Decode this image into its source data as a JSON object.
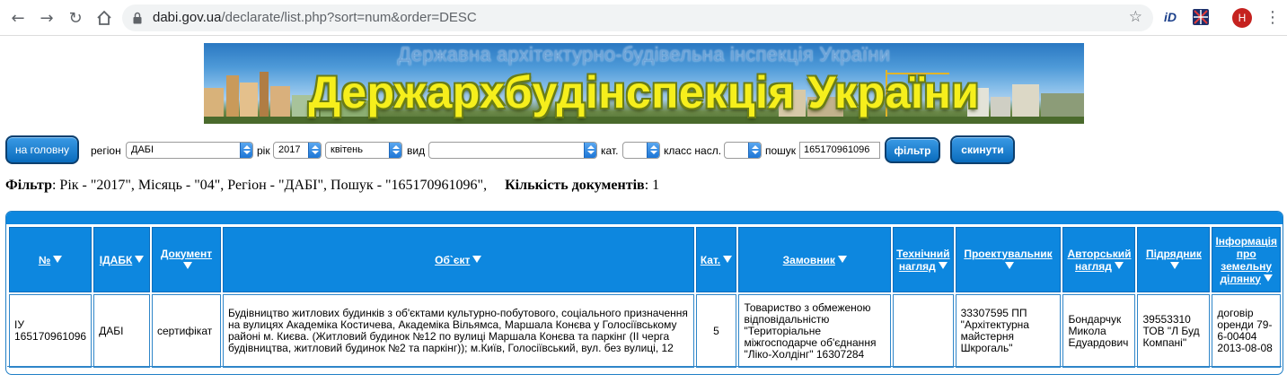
{
  "browser": {
    "url_host": "dabi.gov.ua",
    "url_path": "/declarate/list.php?sort=num&order=DESC",
    "avatar_letter": "H",
    "ext1_label": "iD"
  },
  "banner": {
    "subtitle": "Державна архітектурно-будівельна інспекція України",
    "title": "Держархбудінспекція України"
  },
  "form": {
    "home_button": "на головну",
    "region_label": "регіон",
    "region_value": "ДАБІ",
    "year_label": "рік",
    "year_value": "2017",
    "month_value": "квітень",
    "type_label": "вид",
    "type_value": "",
    "cat_label": "кат.",
    "cat_value": "",
    "class_label": "класс насл.",
    "class_value": "",
    "search_label": "пошук",
    "search_value": "165170961096",
    "filter_button": "фільтр",
    "reset_button": "скинути"
  },
  "filter_summary": {
    "label": "Фільтр",
    "text": ": Рік - \"2017\", Місяць - \"04\", Регіон - \"ДАБІ\", Пошук - \"165170961096\",",
    "count_label": "Кількість документів",
    "count_value": ": 1"
  },
  "table": {
    "headers": [
      "№",
      "ІДАБК",
      "Документ",
      "Об`єкт",
      "Кат.",
      "Замовник",
      "Технічний нагляд",
      "Проектувальник",
      "Авторський нагляд",
      "Підрядник",
      "Інформація про земельну ділянку"
    ],
    "rows": [
      {
        "num": "ІУ 165170961096",
        "idabk": "ДАБІ",
        "document": "сертифікат",
        "object": "Будівництво житлових будинків з об'єктами культурно-побутового, соціального призначення на вулицях Академіка Костичева, Академіка Вільямса, Маршала Конєва у Голосіївському районі м. Києва. (Житловий будинок №12 по вулиці Маршала Конєва та паркінг (ІІ черга будівництва, житловий будинок №2 та паркінг)); м.Київ, Голосіївський, вул. без вулиці, 12",
        "cat": "5",
        "customer": "Товариство з обмеженою відповідальністю \"Територіальне міжгосподарче об'єднання \"Ліко-Холдінг\" 16307284",
        "tech_supervision": "",
        "designer": "33307595 ПП \"Архітектурна майстерня Шкрогаль\"",
        "author_supervision": "Бондарчук Микола Едуардович",
        "contractor": "39553310 ТОВ \"Л Буд Компані\"",
        "land_info": "договір оренди 79-6-00404 2013-08-08"
      }
    ]
  }
}
